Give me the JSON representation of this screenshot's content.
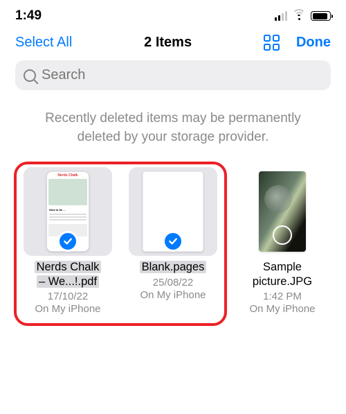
{
  "statusbar": {
    "time": "1:49"
  },
  "navbar": {
    "select_all": "Select All",
    "title": "2 Items",
    "done": "Done"
  },
  "search": {
    "placeholder": "Search"
  },
  "notice": "Recently deleted items may be permanently deleted by your storage provider.",
  "items": [
    {
      "name": "Nerds Chalk\n– We...!.pdf",
      "date": "17/10/22",
      "location": "On My iPhone",
      "selected": true
    },
    {
      "name": "Blank.pages",
      "date": "25/08/22",
      "location": "On My iPhone",
      "selected": true
    },
    {
      "name": "Sample\npicture.JPG",
      "date": "1:42 PM",
      "location": "On My iPhone",
      "selected": false
    }
  ]
}
